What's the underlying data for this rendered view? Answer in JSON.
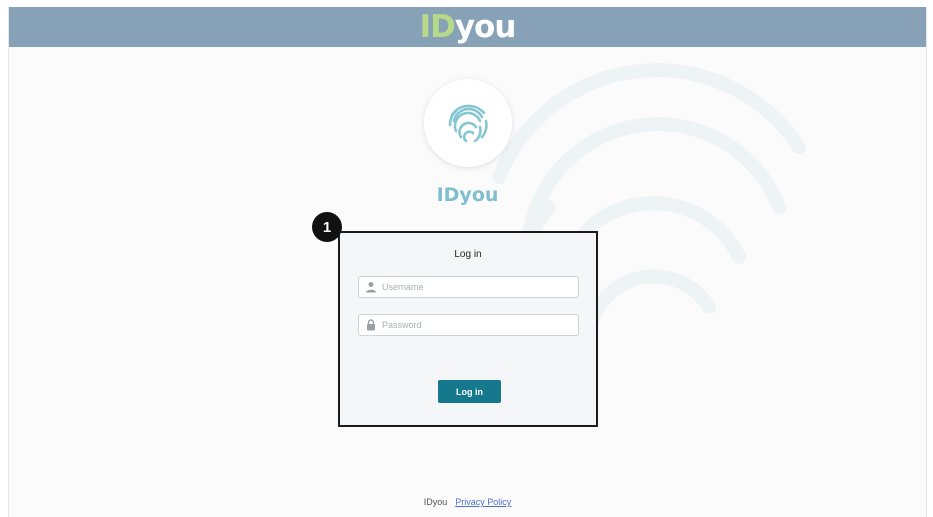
{
  "header": {
    "logo_part1": "ID",
    "logo_part2": "you",
    "logo_colors": {
      "id": "#b6d98a",
      "you": "#ffffff",
      "bar": "#87a1b6"
    }
  },
  "hero": {
    "emblem_icon": "fingerprint-icon",
    "brand_name": "IDyou"
  },
  "annotation": {
    "marker": "1"
  },
  "login": {
    "title": "Log in",
    "username": {
      "icon": "user-icon",
      "placeholder": "Username",
      "value": ""
    },
    "password": {
      "icon": "lock-icon",
      "placeholder": "Password",
      "value": ""
    },
    "submit_label": "Log in",
    "accent_color": "#16788d"
  },
  "footer": {
    "brand": "IDyou",
    "privacy_link": "Privacy Policy"
  }
}
